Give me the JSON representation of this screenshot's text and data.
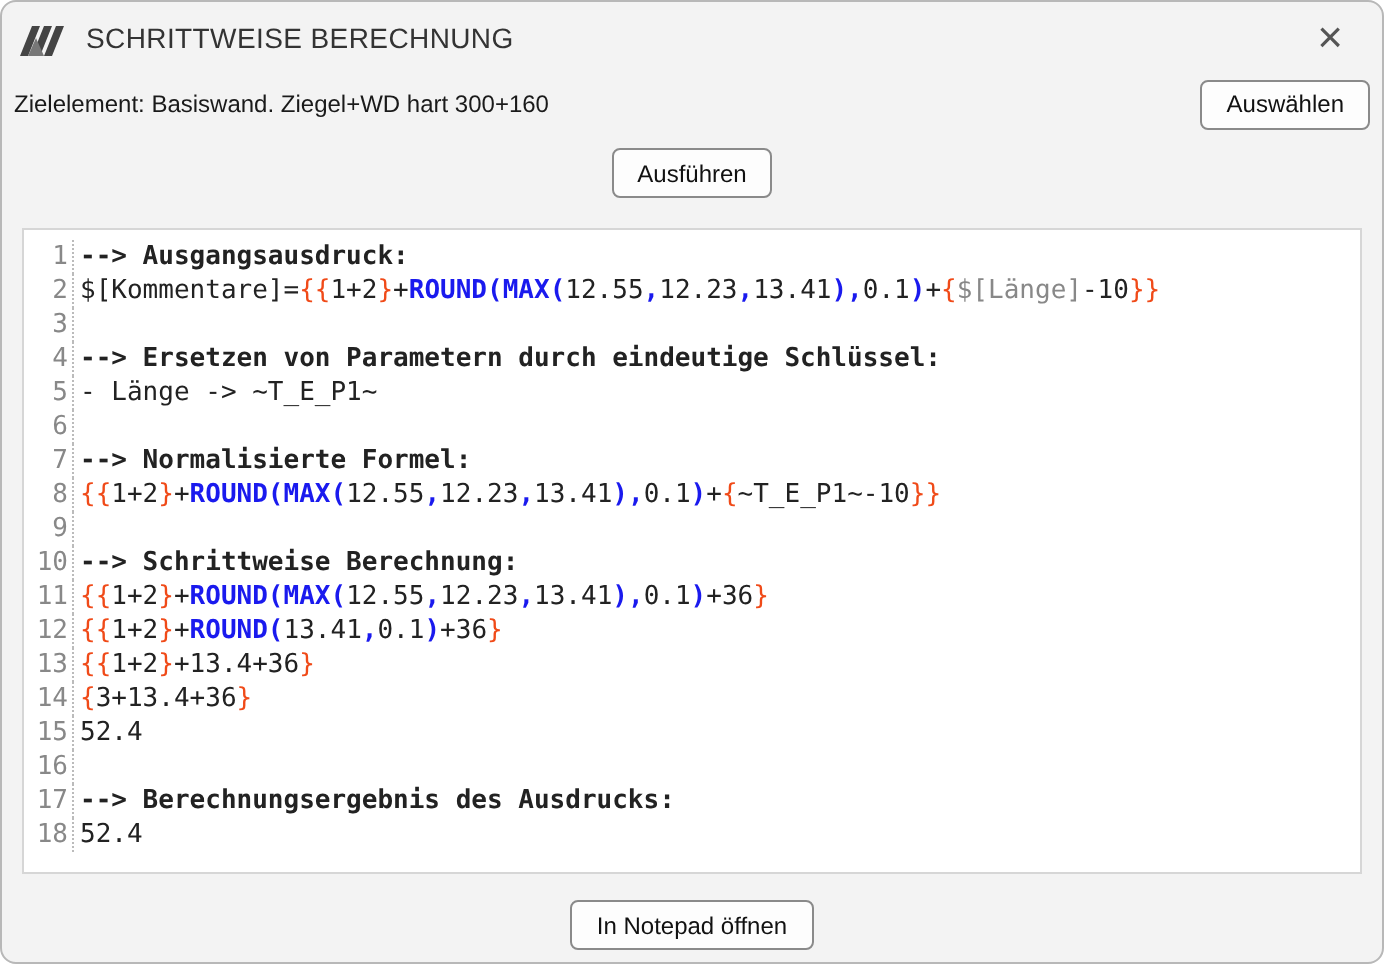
{
  "window": {
    "title": "SCHRITTWEISE BERECHNUNG",
    "close": "×"
  },
  "target": {
    "label": "Zielelement: Basiswand. Ziegel+WD hart 300+160",
    "button": "Auswählen"
  },
  "run_button": "Ausführen",
  "editor": {
    "lines": [
      {
        "number": "1",
        "heading": true,
        "tokens": [
          {
            "kind": "plain",
            "text": "--> Ausgangsausdruck:"
          }
        ]
      },
      {
        "number": "2",
        "heading": false,
        "tokens": [
          {
            "kind": "plain",
            "text": "$[Kommentare]="
          },
          {
            "kind": "brace",
            "text": "{{"
          },
          {
            "kind": "plain",
            "text": "1+2"
          },
          {
            "kind": "brace",
            "text": "}"
          },
          {
            "kind": "plain",
            "text": "+"
          },
          {
            "kind": "func",
            "text": "ROUND(MAX("
          },
          {
            "kind": "plain",
            "text": "12.55"
          },
          {
            "kind": "func",
            "text": ","
          },
          {
            "kind": "plain",
            "text": "12.23"
          },
          {
            "kind": "func",
            "text": ","
          },
          {
            "kind": "plain",
            "text": "13.41"
          },
          {
            "kind": "func",
            "text": "),"
          },
          {
            "kind": "plain",
            "text": "0.1"
          },
          {
            "kind": "func",
            "text": ")"
          },
          {
            "kind": "plain",
            "text": "+"
          },
          {
            "kind": "brace",
            "text": "{"
          },
          {
            "kind": "param",
            "text": "$[Länge]"
          },
          {
            "kind": "plain",
            "text": "-10"
          },
          {
            "kind": "brace",
            "text": "}}"
          }
        ]
      },
      {
        "number": "3"
      },
      {
        "number": "4",
        "heading": true,
        "tokens": [
          {
            "kind": "plain",
            "text": "--> Ersetzen von Parametern durch eindeutige Schlüssel:"
          }
        ]
      },
      {
        "number": "5",
        "heading": false,
        "tokens": [
          {
            "kind": "plain",
            "text": "- Länge -> ~T_E_P1~"
          }
        ]
      },
      {
        "number": "6"
      },
      {
        "number": "7",
        "heading": true,
        "tokens": [
          {
            "kind": "plain",
            "text": "--> Normalisierte Formel:"
          }
        ]
      },
      {
        "number": "8",
        "heading": false,
        "tokens": [
          {
            "kind": "brace",
            "text": "{{"
          },
          {
            "kind": "plain",
            "text": "1+2"
          },
          {
            "kind": "brace",
            "text": "}"
          },
          {
            "kind": "plain",
            "text": "+"
          },
          {
            "kind": "func",
            "text": "ROUND(MAX("
          },
          {
            "kind": "plain",
            "text": "12.55"
          },
          {
            "kind": "func",
            "text": ","
          },
          {
            "kind": "plain",
            "text": "12.23"
          },
          {
            "kind": "func",
            "text": ","
          },
          {
            "kind": "plain",
            "text": "13.41"
          },
          {
            "kind": "func",
            "text": "),"
          },
          {
            "kind": "plain",
            "text": "0.1"
          },
          {
            "kind": "func",
            "text": ")"
          },
          {
            "kind": "plain",
            "text": "+"
          },
          {
            "kind": "brace",
            "text": "{"
          },
          {
            "kind": "plain",
            "text": "~T_E_P1~-10"
          },
          {
            "kind": "brace",
            "text": "}}"
          }
        ]
      },
      {
        "number": "9"
      },
      {
        "number": "10",
        "heading": true,
        "tokens": [
          {
            "kind": "plain",
            "text": "--> Schrittweise Berechnung:"
          }
        ]
      },
      {
        "number": "11",
        "heading": false,
        "tokens": [
          {
            "kind": "brace",
            "text": "{{"
          },
          {
            "kind": "plain",
            "text": "1+2"
          },
          {
            "kind": "brace",
            "text": "}"
          },
          {
            "kind": "plain",
            "text": "+"
          },
          {
            "kind": "func",
            "text": "ROUND(MAX("
          },
          {
            "kind": "plain",
            "text": "12.55"
          },
          {
            "kind": "func",
            "text": ","
          },
          {
            "kind": "plain",
            "text": "12.23"
          },
          {
            "kind": "func",
            "text": ","
          },
          {
            "kind": "plain",
            "text": "13.41"
          },
          {
            "kind": "func",
            "text": "),"
          },
          {
            "kind": "plain",
            "text": "0.1"
          },
          {
            "kind": "func",
            "text": ")"
          },
          {
            "kind": "plain",
            "text": "+36"
          },
          {
            "kind": "brace",
            "text": "}"
          }
        ]
      },
      {
        "number": "12",
        "heading": false,
        "tokens": [
          {
            "kind": "brace",
            "text": "{{"
          },
          {
            "kind": "plain",
            "text": "1+2"
          },
          {
            "kind": "brace",
            "text": "}"
          },
          {
            "kind": "plain",
            "text": "+"
          },
          {
            "kind": "func",
            "text": "ROUND("
          },
          {
            "kind": "plain",
            "text": "13.41"
          },
          {
            "kind": "func",
            "text": ","
          },
          {
            "kind": "plain",
            "text": "0.1"
          },
          {
            "kind": "func",
            "text": ")"
          },
          {
            "kind": "plain",
            "text": "+36"
          },
          {
            "kind": "brace",
            "text": "}"
          }
        ]
      },
      {
        "number": "13",
        "heading": false,
        "tokens": [
          {
            "kind": "brace",
            "text": "{{"
          },
          {
            "kind": "plain",
            "text": "1+2"
          },
          {
            "kind": "brace",
            "text": "}"
          },
          {
            "kind": "plain",
            "text": "+13.4+36"
          },
          {
            "kind": "brace",
            "text": "}"
          }
        ]
      },
      {
        "number": "14",
        "heading": false,
        "tokens": [
          {
            "kind": "brace",
            "text": "{"
          },
          {
            "kind": "plain",
            "text": "3+13.4+36"
          },
          {
            "kind": "brace",
            "text": "}"
          }
        ]
      },
      {
        "number": "15",
        "heading": false,
        "tokens": [
          {
            "kind": "plain",
            "text": "52.4"
          }
        ]
      },
      {
        "number": "16"
      },
      {
        "number": "17",
        "heading": true,
        "tokens": [
          {
            "kind": "plain",
            "text": "--> Berechnungsergebnis des Ausdrucks:"
          }
        ]
      },
      {
        "number": "18",
        "heading": false,
        "tokens": [
          {
            "kind": "plain",
            "text": "52.4"
          }
        ]
      }
    ]
  },
  "notepad_button": "In Notepad öffnen"
}
